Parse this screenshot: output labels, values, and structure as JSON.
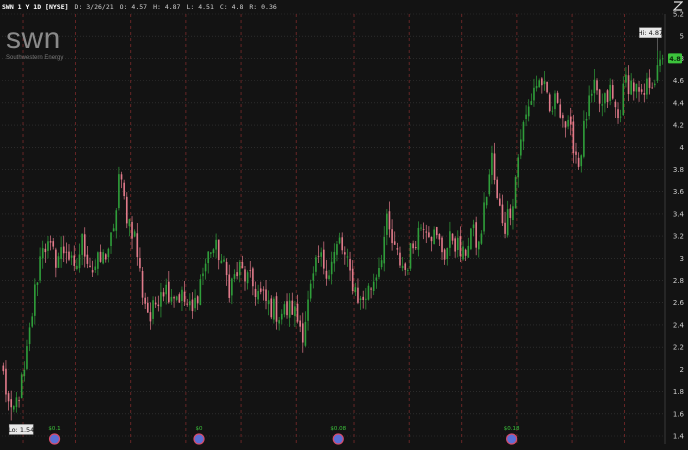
{
  "header": {
    "ticker": "SWN 1 Y 1D [NYSE]",
    "date": "D: 3/26/21",
    "open": "O: 4.57",
    "high": "H: 4.87",
    "low": "L: 4.51",
    "close": "C: 4.8",
    "range": "R: 0.36"
  },
  "watermark": {
    "logo": "SWN",
    "company": "Southwestern Energy"
  },
  "badges": {
    "hi_label": "Hi: 4.87",
    "lo_label": "Lo: 1.54",
    "last_price": "4.8"
  },
  "colors": {
    "background": "#131313",
    "grid": "#3a3a3a",
    "month_line": "#7a2a2a",
    "up": "#2f9e3a",
    "down": "#e07a8a",
    "last_price_badge": "#3cc43c"
  },
  "corner_icon": "expand-icon",
  "chart_data": {
    "type": "candlestick",
    "ylim": [
      1.4,
      5.2
    ],
    "y_ticks": [
      1.4,
      1.6,
      1.8,
      2,
      2.2,
      2.4,
      2.6,
      2.8,
      3,
      3.2,
      3.4,
      3.6,
      3.8,
      4,
      4.2,
      4.4,
      4.6,
      4.8,
      5,
      5.2
    ],
    "y_tick_labels": [
      "1.4",
      "1.6",
      "1.8",
      "2",
      "2.2",
      "2.4",
      "2.6",
      "2.8",
      "3",
      "3.2",
      "3.4",
      "3.6",
      "3.8",
      "4",
      "4.2",
      "4.4",
      "4.6",
      "4.8",
      "5",
      "5.2"
    ],
    "num_bars": 252,
    "month_boundaries": [
      8,
      28,
      49,
      70,
      91,
      112,
      134,
      155,
      175,
      196,
      217,
      237
    ],
    "dividend_markers": [
      {
        "bar": 20,
        "label": "$0.1"
      },
      {
        "bar": 75,
        "label": "$0"
      },
      {
        "bar": 128,
        "label": "$0.08"
      },
      {
        "bar": 194,
        "label": "$0.18"
      }
    ],
    "earnings_markers": [
      20,
      75,
      128,
      194
    ],
    "high": 4.87,
    "low": 1.54,
    "last": 4.8,
    "path_anchors": [
      [
        0,
        1.95
      ],
      [
        3,
        1.55
      ],
      [
        8,
        1.95
      ],
      [
        12,
        2.7
      ],
      [
        15,
        3.15
      ],
      [
        20,
        3.0
      ],
      [
        24,
        3.1
      ],
      [
        27,
        2.85
      ],
      [
        30,
        3.15
      ],
      [
        34,
        2.9
      ],
      [
        38,
        3.0
      ],
      [
        42,
        3.2
      ],
      [
        44,
        3.75
      ],
      [
        47,
        3.4
      ],
      [
        50,
        3.2
      ],
      [
        53,
        2.7
      ],
      [
        56,
        2.45
      ],
      [
        60,
        2.75
      ],
      [
        64,
        2.7
      ],
      [
        68,
        2.65
      ],
      [
        72,
        2.5
      ],
      [
        75,
        2.8
      ],
      [
        79,
        3.1
      ],
      [
        82,
        3.05
      ],
      [
        86,
        2.75
      ],
      [
        90,
        2.9
      ],
      [
        95,
        2.75
      ],
      [
        100,
        2.6
      ],
      [
        105,
        2.5
      ],
      [
        110,
        2.55
      ],
      [
        114,
        2.35
      ],
      [
        117,
        2.7
      ],
      [
        120,
        3.0
      ],
      [
        124,
        2.9
      ],
      [
        128,
        3.15
      ],
      [
        132,
        2.85
      ],
      [
        136,
        2.6
      ],
      [
        140,
        2.75
      ],
      [
        143,
        2.95
      ],
      [
        146,
        3.3
      ],
      [
        149,
        3.05
      ],
      [
        153,
        2.9
      ],
      [
        157,
        3.2
      ],
      [
        160,
        3.35
      ],
      [
        164,
        3.2
      ],
      [
        168,
        3.05
      ],
      [
        171,
        3.2
      ],
      [
        175,
        3.0
      ],
      [
        178,
        3.25
      ],
      [
        181,
        3.1
      ],
      [
        184,
        3.6
      ],
      [
        186,
        3.9
      ],
      [
        188,
        3.5
      ],
      [
        191,
        3.3
      ],
      [
        194,
        3.55
      ],
      [
        197,
        4.1
      ],
      [
        200,
        4.35
      ],
      [
        202,
        4.55
      ],
      [
        205,
        4.6
      ],
      [
        208,
        4.3
      ],
      [
        211,
        4.45
      ],
      [
        214,
        4.2
      ],
      [
        217,
        4.05
      ],
      [
        219,
        3.85
      ],
      [
        222,
        4.3
      ],
      [
        225,
        4.5
      ],
      [
        228,
        4.35
      ],
      [
        231,
        4.5
      ],
      [
        234,
        4.25
      ],
      [
        237,
        4.6
      ],
      [
        240,
        4.55
      ],
      [
        243,
        4.4
      ],
      [
        246,
        4.6
      ],
      [
        249,
        4.65
      ],
      [
        251,
        4.8
      ]
    ]
  }
}
